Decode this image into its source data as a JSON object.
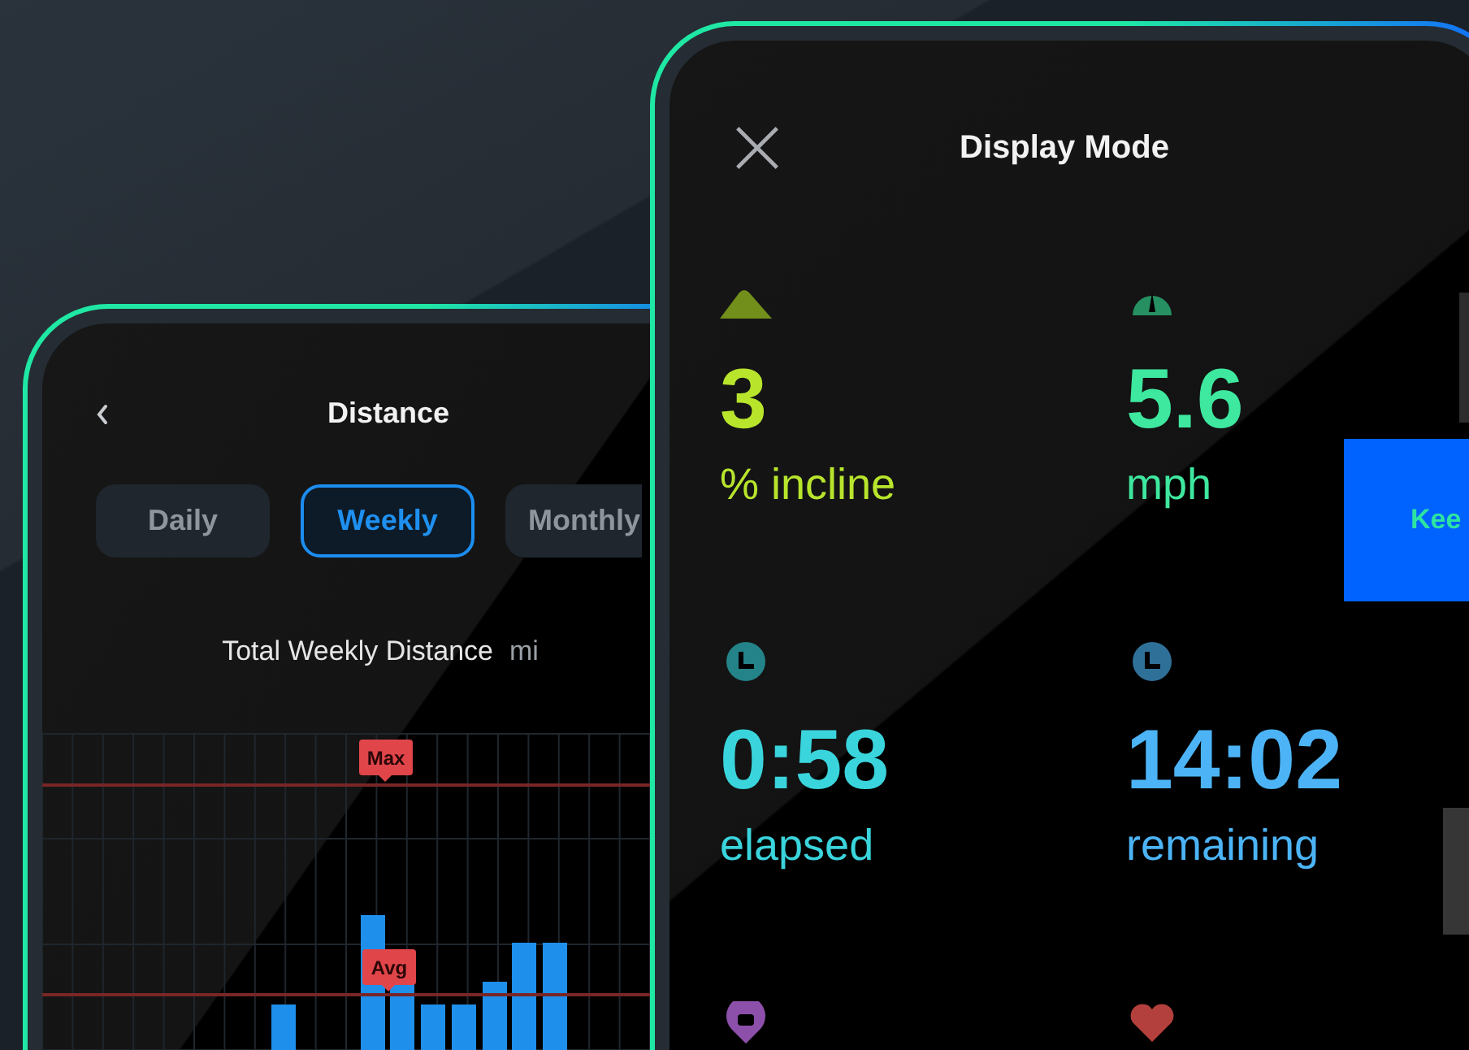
{
  "left_phone": {
    "title": "Distance",
    "tabs": [
      {
        "label": "Daily",
        "selected": false
      },
      {
        "label": "Weekly",
        "selected": true
      },
      {
        "label": "Monthly",
        "selected": false
      }
    ],
    "chart": {
      "title": "Total Weekly Distance",
      "unit": "mi",
      "markers": [
        {
          "label": "Max"
        },
        {
          "label": "Avg"
        }
      ]
    }
  },
  "right_phone": {
    "title": "Display Mode",
    "metrics": [
      {
        "kind": "incline",
        "value": "3",
        "unit": "% incline",
        "color": "#b8e52c"
      },
      {
        "kind": "speed",
        "value": "5.6",
        "unit": "mph",
        "color": "#3ee89e"
      },
      {
        "kind": "clock",
        "value": "0:58",
        "unit": "elapsed",
        "color": "#3ad4dc"
      },
      {
        "kind": "clock",
        "value": "14:02",
        "unit": "remaining",
        "color": "#4cb4f6"
      },
      {
        "kind": "pin",
        "color": "#8c50aa"
      },
      {
        "kind": "heart",
        "color": "#b3403c"
      }
    ]
  },
  "side_button": {
    "label": "Kee"
  }
}
